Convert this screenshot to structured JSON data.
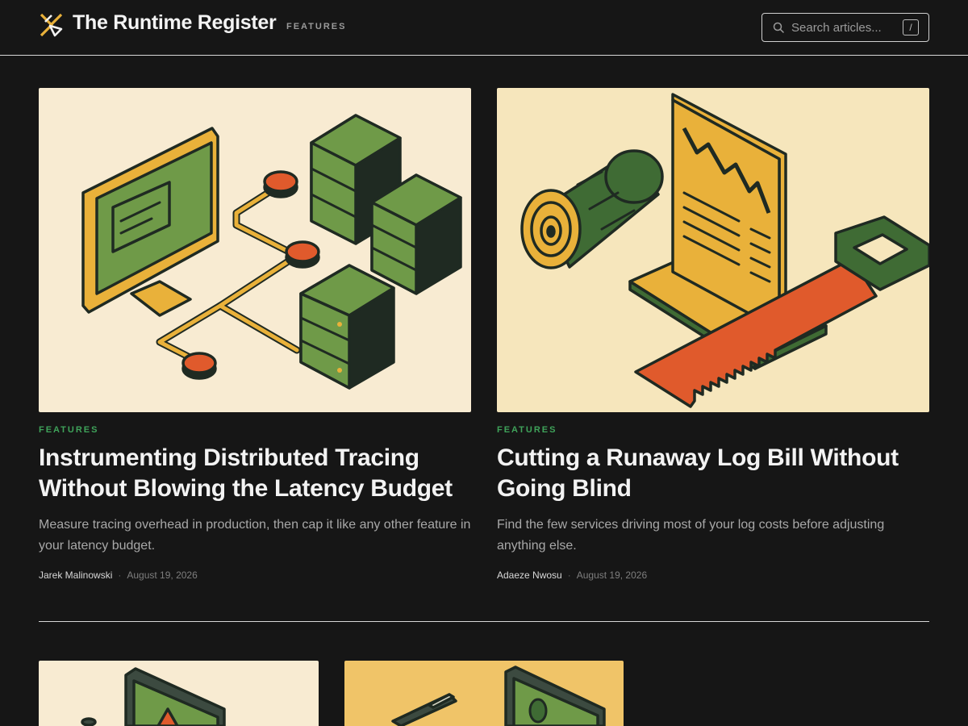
{
  "site": {
    "title": "The Runtime Register",
    "nav": [
      {
        "label": "FEATURES"
      }
    ],
    "search": {
      "placeholder": "Search articles...",
      "shortcut": "/"
    }
  },
  "articles": [
    {
      "tag": "FEATURES",
      "title": "Instrumenting Distributed Tracing Without Blowing the Latency Budget",
      "excerpt": "Measure tracing overhead in production, then cap it like any other feature in your latency budget.",
      "author": "Jarek Malinowski",
      "date": "August 19, 2026"
    },
    {
      "tag": "FEATURES",
      "title": "Cutting a Runaway Log Bill Without Going Blind",
      "excerpt": "Find the few services driving most of your log costs before adjusting anything else.",
      "author": "Adaeze Nwosu",
      "date": "August 19, 2026"
    }
  ],
  "meta_separator": "·",
  "icons": {
    "logo": "crossed-chevron-logo-icon",
    "search": "search-icon"
  },
  "colors": {
    "background": "#161616",
    "accent_tag": "#3fa35a",
    "illustration_yellow": "#e9b13a",
    "illustration_green": "#6f9a48",
    "illustration_orange": "#e05a2c",
    "illustration_dark": "#1f2a22"
  }
}
